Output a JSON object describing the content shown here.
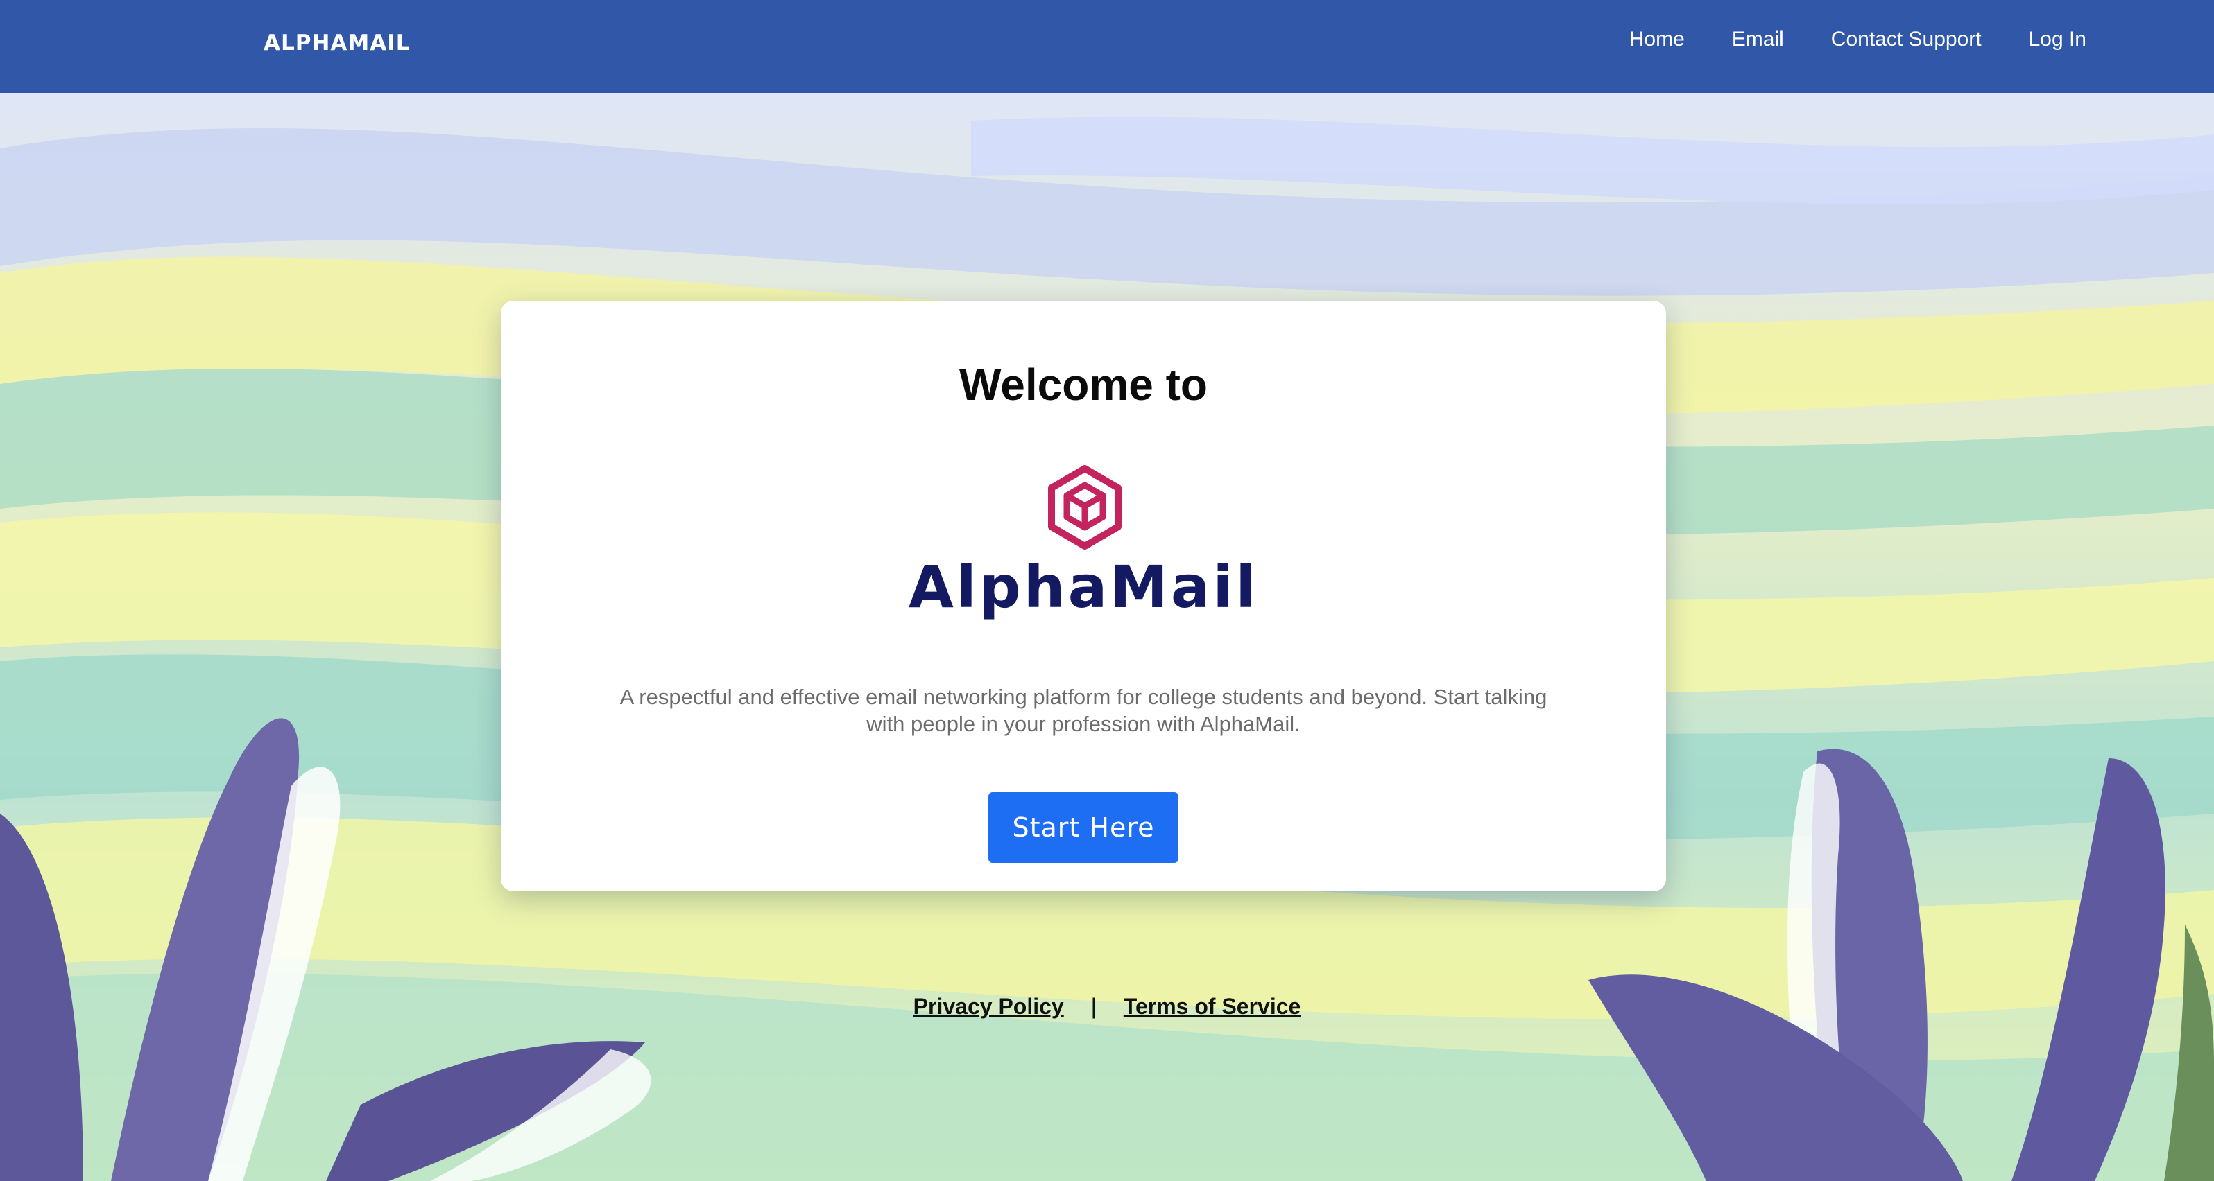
{
  "navbar": {
    "brand": "ALPHAMAIL",
    "links": [
      "Home",
      "Email",
      "Contact Support",
      "Log In"
    ]
  },
  "card": {
    "title": "Welcome to",
    "logo_text": "AlphaMail",
    "tagline": "A respectful and effective email networking platform for college students and beyond. Start talking with people in your profession with AlphaMail.",
    "cta_label": "Start Here"
  },
  "footer": {
    "privacy_label": "Privacy Policy",
    "separator": "|",
    "terms_label": "Terms of Service"
  },
  "colors": {
    "navbar": "#3057a8",
    "logo_mark": "#c4245e",
    "logo_text": "#141a62",
    "cta": "#1e6ef3"
  },
  "icons": {
    "logo_mark": "hexagon-cube-icon"
  }
}
